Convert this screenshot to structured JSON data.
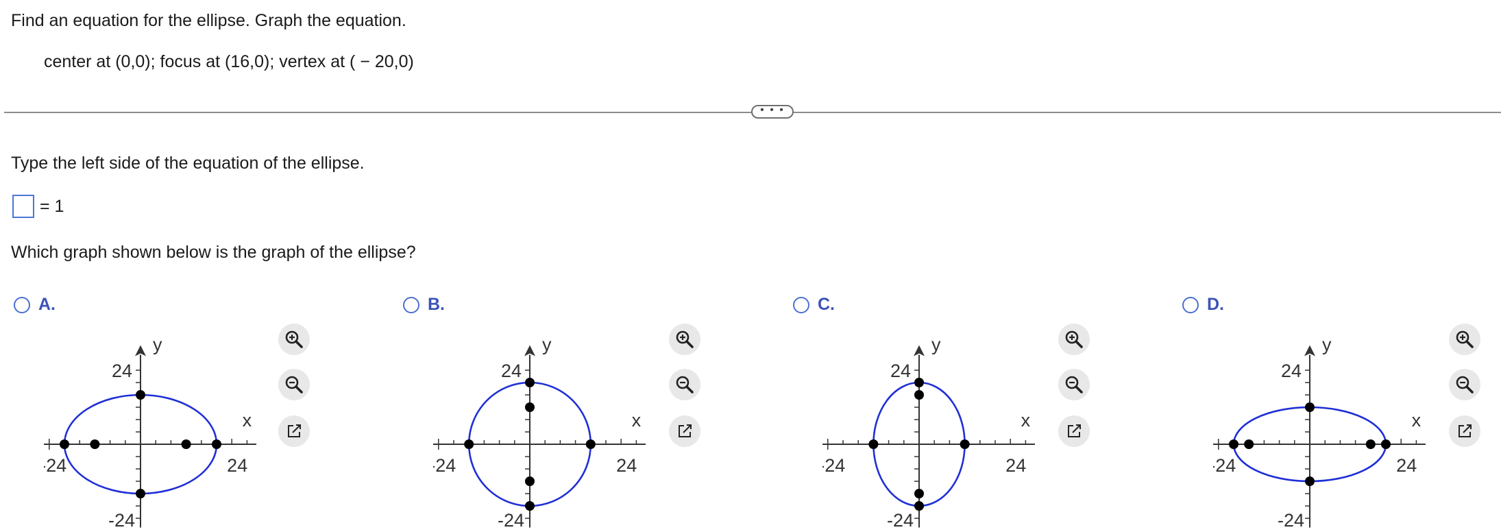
{
  "question": {
    "instruction": "Find an equation for the ellipse.  Graph the equation.",
    "given": "center at (0,0); focus at (16,0); vertex at ( − 20,0)"
  },
  "more_button": "• • •",
  "part1": {
    "prompt": "Type the left side of the equation of the ellipse.",
    "answer_value": "",
    "equals_text": "= 1"
  },
  "part2": {
    "prompt": "Which graph shown below is the graph of the ellipse?"
  },
  "choices": [
    {
      "letter": "A.",
      "a": 20,
      "b": 16,
      "foci_axis": "x",
      "c": 12
    },
    {
      "letter": "B.",
      "a": 16,
      "b": 20,
      "foci_axis": "y",
      "c": 12
    },
    {
      "letter": "C.",
      "a": 12,
      "b": 20,
      "foci_axis": "y",
      "c": 16
    },
    {
      "letter": "D.",
      "a": 20,
      "b": 12,
      "foci_axis": "x",
      "c": 16
    }
  ],
  "graph": {
    "tick_label_pos": "24",
    "tick_label_neg": "-24",
    "x_label": "x",
    "y_label": "y"
  },
  "colors": {
    "ellipse": "#1f2fd6",
    "axis": "#333333",
    "radio": "#4a6fd0",
    "choice_label": "#3c52b8",
    "answer_box_border": "#4a77d6"
  },
  "icons": [
    "zoom-in-icon",
    "zoom-out-icon",
    "external-link-icon"
  ]
}
